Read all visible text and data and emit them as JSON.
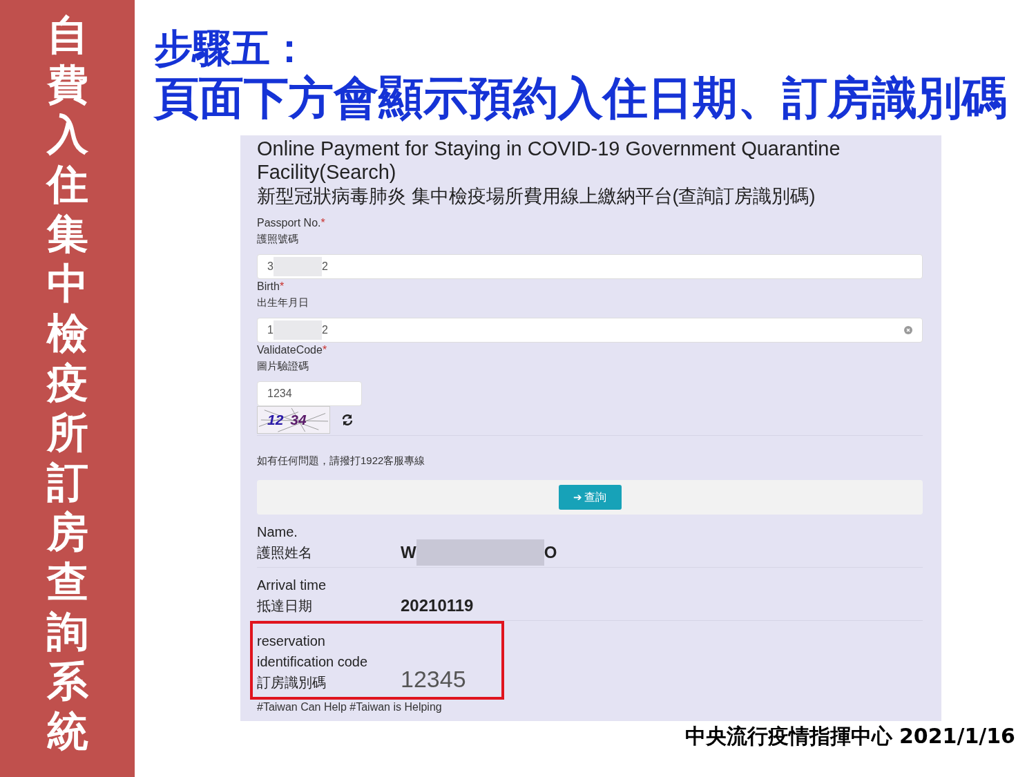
{
  "side_title": "自費入住集中檢疫所訂房查詢系統",
  "heading": {
    "step": "步驟五：",
    "text": "頁面下方會顯示預約入住日期、訂房識別碼"
  },
  "screenshot": {
    "title_en": "Online Payment for Staying in COVID-19 Government Quarantine Facility(Search)",
    "title_zh": "新型冠狀病毒肺炎 集中檢疫場所費用線上繳納平台(查詢訂房識別碼)",
    "fields": [
      {
        "label": "Passport No.",
        "required_mark": "*",
        "label_zh": "護照號碼",
        "value_parts": [
          "3",
          "2"
        ],
        "kind": "text"
      },
      {
        "label": "Birth",
        "required_mark": "*",
        "label_zh": "出生年月日",
        "value_parts": [
          "1",
          "2"
        ],
        "kind": "date"
      },
      {
        "label": "ValidateCode",
        "required_mark": "*",
        "label_zh": "圖片驗證碼",
        "value_parts": [
          "1234"
        ],
        "kind": "code"
      }
    ],
    "captcha": {
      "text_parts": [
        "12",
        "34"
      ]
    },
    "help_text": "如有任何問題，請撥打1922客服專線",
    "search_button": {
      "icon": "➔",
      "label": "查詢"
    },
    "results": [
      {
        "labels": [
          "Name.",
          "護照姓名"
        ],
        "value_parts": [
          "W",
          "O"
        ],
        "kind": "info",
        "highlighted": false
      },
      {
        "labels": [
          "Arrival time",
          "抵達日期"
        ],
        "value_parts": [
          "20210119"
        ],
        "kind": "info",
        "highlighted": false
      },
      {
        "labels": [
          "reservation",
          "identification code",
          "訂房識別碼"
        ],
        "value_parts": [
          "12345"
        ],
        "kind": "code",
        "highlighted": true
      }
    ],
    "footer": "#Taiwan Can Help #Taiwan is Helping"
  },
  "credit": "中央流行疫情指揮中心 2021/1/16"
}
